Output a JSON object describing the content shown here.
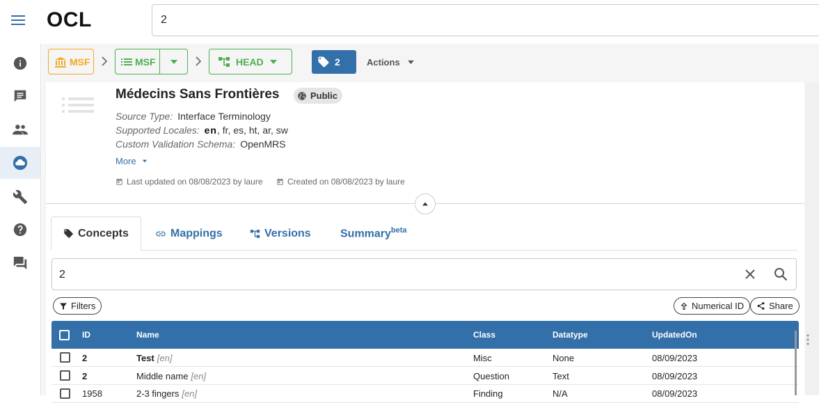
{
  "app": {
    "logo": "OCL"
  },
  "search": {
    "value": "2"
  },
  "nav": [
    {
      "name": "info",
      "icon": "info-icon"
    },
    {
      "name": "chat",
      "icon": "comment-icon"
    },
    {
      "name": "people",
      "icon": "people-icon"
    },
    {
      "name": "cloud",
      "icon": "cloud-icon",
      "active": true
    },
    {
      "name": "tools",
      "icon": "wrench-icon"
    },
    {
      "name": "help",
      "icon": "help-icon"
    },
    {
      "name": "forum",
      "icon": "forum-icon"
    }
  ],
  "breadcrumb": {
    "org": "MSF",
    "source": "MSF",
    "version": "HEAD",
    "tag_count": "2",
    "actions": "Actions"
  },
  "source": {
    "name": "Médecins Sans Frontières",
    "visibility": "Public",
    "type_label": "Source Type:",
    "type_value": "Interface Terminology",
    "locales_label": "Supported Locales:",
    "locale_default": "en",
    "locales_rest": ", fr, es, ht, ar, sw",
    "schema_label": "Custom Validation Schema:",
    "schema_value": "OpenMRS",
    "more": "More",
    "updated": "Last updated on 08/08/2023 by laure",
    "created": "Created on 08/08/2023 by laure"
  },
  "tabs": [
    {
      "label": "Concepts",
      "icon": "tag-icon",
      "active": true
    },
    {
      "label": "Mappings",
      "icon": "link-icon"
    },
    {
      "label": "Versions",
      "icon": "version-tree-icon"
    },
    {
      "label": "Summary",
      "sup": "beta"
    }
  ],
  "concept_search": {
    "value": "2"
  },
  "chips": {
    "filters": "Filters",
    "sort": "Numerical ID",
    "share": "Share"
  },
  "table": {
    "columns": [
      "ID",
      "Name",
      "Class",
      "Datatype",
      "UpdatedOn"
    ],
    "rows": [
      {
        "id": "2",
        "name": "Test",
        "locale": "[en]",
        "class": "Misc",
        "datatype": "None",
        "updated": "08/09/2023",
        "bold": true
      },
      {
        "id": "2",
        "name": "Middle name",
        "locale": "[en]",
        "class": "Question",
        "datatype": "Text",
        "updated": "08/09/2023",
        "bold": false
      },
      {
        "id": "1958",
        "name": "2-3 fingers",
        "locale": "[en]",
        "class": "Finding",
        "datatype": "N/A",
        "updated": "08/09/2023",
        "bold": false
      }
    ]
  },
  "colors": {
    "primary": "#336fa9",
    "org": "#f5a623",
    "source": "#4caf50"
  }
}
